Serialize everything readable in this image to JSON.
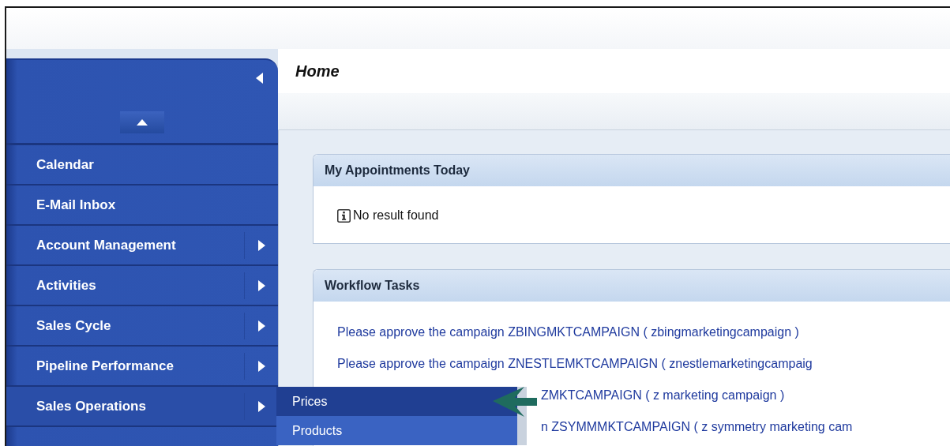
{
  "page": {
    "title": "Home"
  },
  "sidebar": {
    "items": [
      {
        "label": "Calendar",
        "has_submenu": false,
        "expanded": false
      },
      {
        "label": "E-Mail Inbox",
        "has_submenu": false,
        "expanded": false
      },
      {
        "label": "Account Management",
        "has_submenu": true,
        "expanded": false
      },
      {
        "label": "Activities",
        "has_submenu": true,
        "expanded": false
      },
      {
        "label": "Sales Cycle",
        "has_submenu": true,
        "expanded": false
      },
      {
        "label": "Pipeline Performance",
        "has_submenu": true,
        "expanded": false
      },
      {
        "label": "Sales Operations",
        "has_submenu": true,
        "expanded": true
      }
    ]
  },
  "submenu": {
    "items": [
      {
        "label": "Prices",
        "selected": true
      },
      {
        "label": "Products",
        "selected": false
      }
    ]
  },
  "appointments": {
    "title": "My Appointments Today",
    "message": "No result found"
  },
  "workflow": {
    "title": "Workflow Tasks",
    "tasks": [
      {
        "text": "Please approve the campaign ZBINGMKTCAMPAIGN ( zbingmarketingcampaign )",
        "covered": false
      },
      {
        "text": "Please approve the campaign ZNESTLEMKTCAMPAIGN ( znestlemarketingcampaig",
        "covered": false
      },
      {
        "text": "ZMKTCAMPAIGN ( z marketing campaign )",
        "covered": true
      },
      {
        "text": "n ZSYMMMKTCAMPAIGN ( z symmetry marketing cam",
        "covered": true
      }
    ]
  }
}
